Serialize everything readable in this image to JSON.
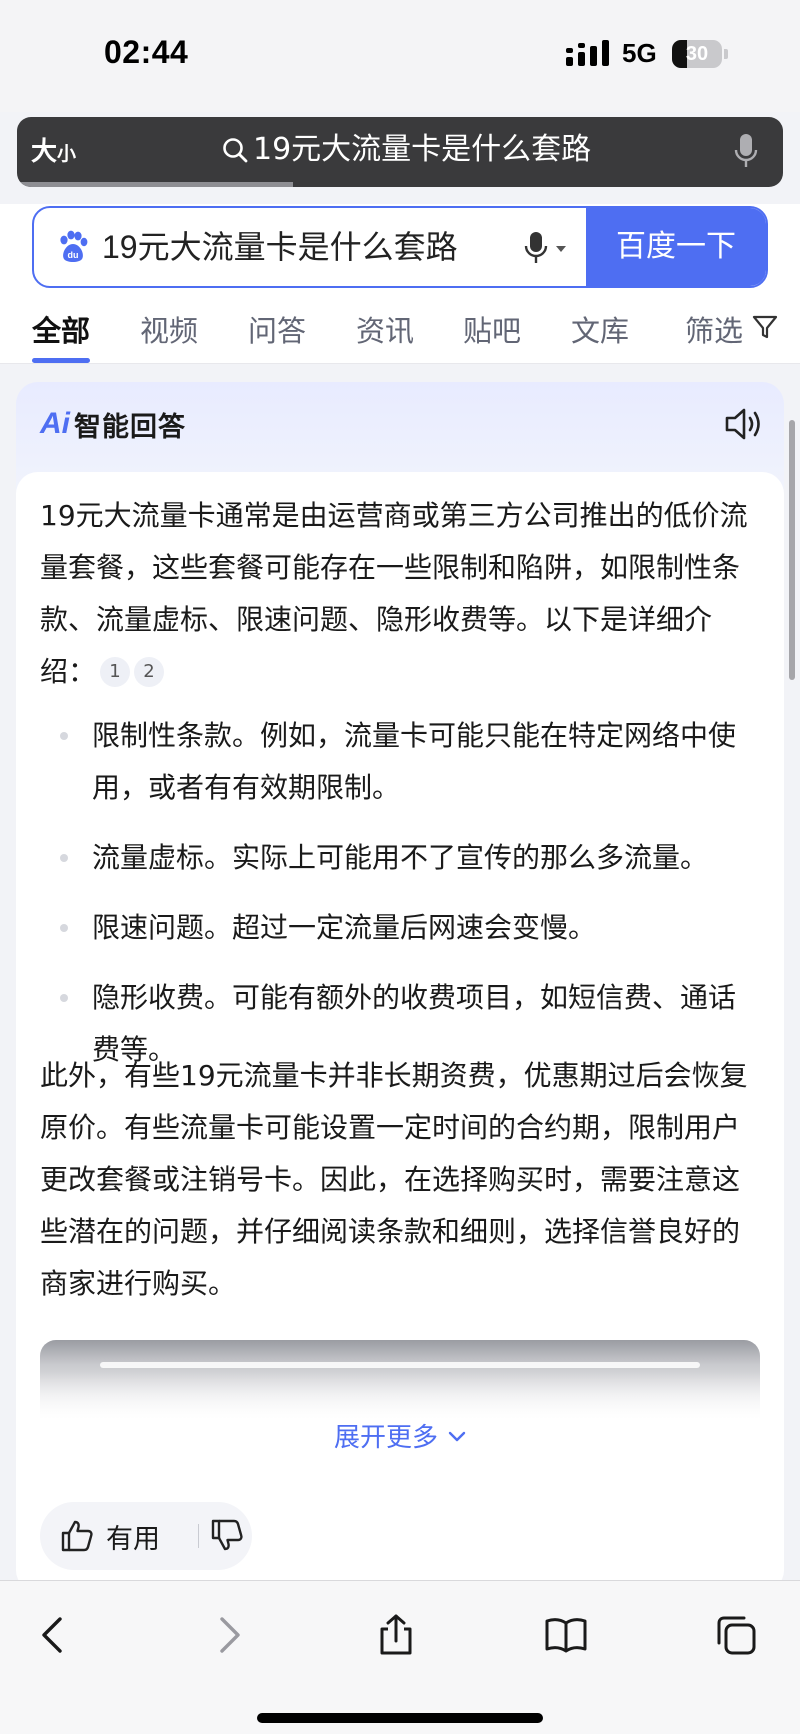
{
  "status_bar": {
    "time": "02:44",
    "network": "5G",
    "battery_level": "30",
    "battery_fraction": 0.3
  },
  "address_bar": {
    "text_size_label_big": "大",
    "text_size_label_small": "小",
    "url_text": "19元大流量卡是什么套路",
    "load_progress": 0.36
  },
  "search": {
    "query": "19元大流量卡是什么套路",
    "submit_label": "百度一下"
  },
  "tabs": [
    {
      "label": "全部",
      "active": true
    },
    {
      "label": "视频"
    },
    {
      "label": "问答"
    },
    {
      "label": "资讯"
    },
    {
      "label": "贴吧"
    },
    {
      "label": "文库"
    },
    {
      "label": "筛选"
    }
  ],
  "ai_answer": {
    "logo": "Ai",
    "title": "智能回答",
    "intro": "19元大流量卡通常是由运营商或第三方公司推出的低价流量套餐，这些套餐可能存在一些限制和陷阱，如限制性条款、流量虚标、限速问题、隐形收费等。以下是详细介绍：",
    "citations": [
      "1",
      "2"
    ],
    "bullets": [
      "限制性条款。例如，流量卡可能只能在特定网络中使用，或者有有效期限制。",
      "流量虚标。实际上可能用不了宣传的那么多流量。",
      "限速问题。超过一定流量后网速会变慢。",
      "隐形收费。可能有额外的收费项目，如短信费、通话费等。"
    ],
    "conclusion": "此外，有些19元流量卡并非长期资费，优惠期过后会恢复原价。有些流量卡可能设置一定时间的合约期，限制用户更改套餐或注销号卡。因此，在选择购买时，需要注意这些潜在的问题，并仔细阅读条款和细则，选择信誉良好的商家进行购买。",
    "expand_label": "展开更多",
    "useful_label": "有用"
  },
  "icons": {
    "search": "search-icon",
    "mic": "microphone-icon",
    "paw": "baidu-paw-icon",
    "filter": "filter-icon",
    "speaker": "speaker-icon",
    "thumbs_up": "thumbs-up-icon",
    "thumbs_down": "thumbs-down-icon",
    "back": "back-arrow-icon",
    "forward": "forward-arrow-icon",
    "share": "share-icon",
    "bookmarks": "book-icon",
    "tabs": "tabs-icon"
  },
  "colors": {
    "accent": "#4e6ef2",
    "address_bar": "#3a3a3c"
  }
}
